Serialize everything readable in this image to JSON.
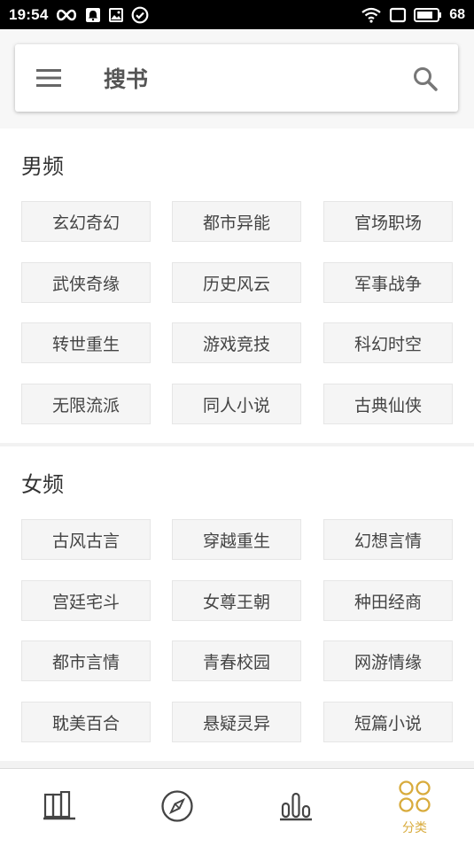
{
  "status_bar": {
    "time": "19:54",
    "battery": "68",
    "icons": [
      "infinity-icon",
      "notification-icon",
      "image-icon",
      "check-circle-icon",
      "wifi-icon",
      "screen-icon",
      "battery-icon"
    ]
  },
  "search_bar": {
    "title": "搜书",
    "menu_icon": "menu-icon",
    "search_icon": "search-icon"
  },
  "sections": {
    "male": {
      "title": "男频",
      "tags": [
        "玄幻奇幻",
        "都市异能",
        "官场职场",
        "武侠奇缘",
        "历史风云",
        "军事战争",
        "转世重生",
        "游戏竞技",
        "科幻时空",
        "无限流派",
        "同人小说",
        "古典仙侠"
      ]
    },
    "female": {
      "title": "女频",
      "tags": [
        "古风古言",
        "穿越重生",
        "幻想言情",
        "宫廷宅斗",
        "女尊王朝",
        "种田经商",
        "都市言情",
        "青春校园",
        "网游情缘",
        "耽美百合",
        "悬疑灵异",
        "短篇小说"
      ]
    }
  },
  "bottom_nav": {
    "items": [
      {
        "icon": "bookshelf-icon"
      },
      {
        "icon": "compass-icon"
      },
      {
        "icon": "ranking-icon"
      },
      {
        "icon": "category-icon",
        "label": "分类",
        "active": true
      }
    ],
    "active_color": "#d8ab3c",
    "inactive_color": "#444444"
  }
}
